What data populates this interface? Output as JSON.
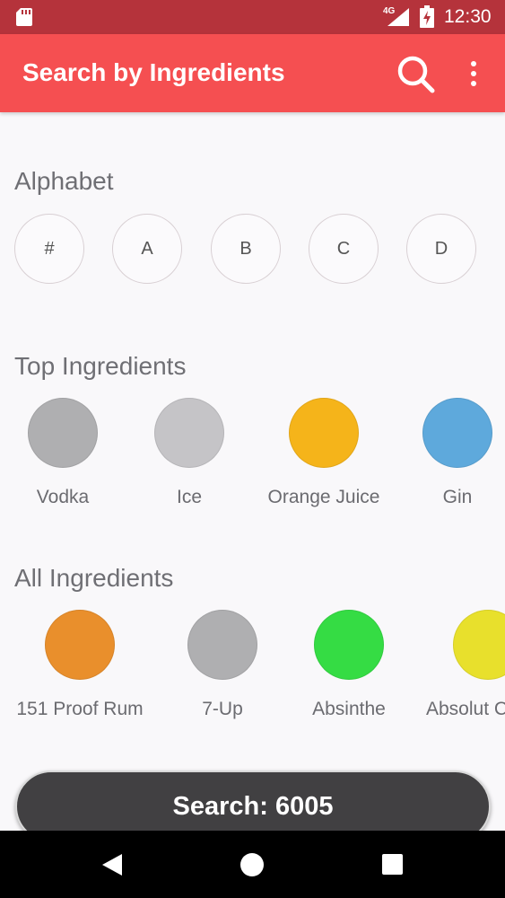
{
  "status_bar": {
    "network": "4G",
    "time": "12:30"
  },
  "app_bar": {
    "title": "Search by Ingredients",
    "search_icon": "search-icon",
    "menu_icon": "more-vert-icon"
  },
  "alphabet": {
    "title": "Alphabet",
    "letters": [
      "#",
      "A",
      "B",
      "C",
      "D"
    ]
  },
  "top_ingredients": {
    "title": "Top Ingredients",
    "items": [
      {
        "label": "Vodka",
        "color": "#afafb1"
      },
      {
        "label": "Ice",
        "color": "#c5c4c7"
      },
      {
        "label": "Orange Juice",
        "color": "#f5b41a"
      },
      {
        "label": "Gin",
        "color": "#5ea9dc"
      }
    ]
  },
  "all_ingredients": {
    "title": "All Ingredients",
    "items": [
      {
        "label": "151 Proof Rum",
        "color": "#e98f2c"
      },
      {
        "label": "7-Up",
        "color": "#afafb1"
      },
      {
        "label": "Absinthe",
        "color": "#35dc44"
      },
      {
        "label": "Absolut C",
        "color": "#e8e02c"
      }
    ]
  },
  "search_button": {
    "label": "Search: 6005"
  },
  "nav_bar": {
    "back_icon": "back-icon",
    "home_icon": "home-icon",
    "recents_icon": "recents-icon"
  }
}
